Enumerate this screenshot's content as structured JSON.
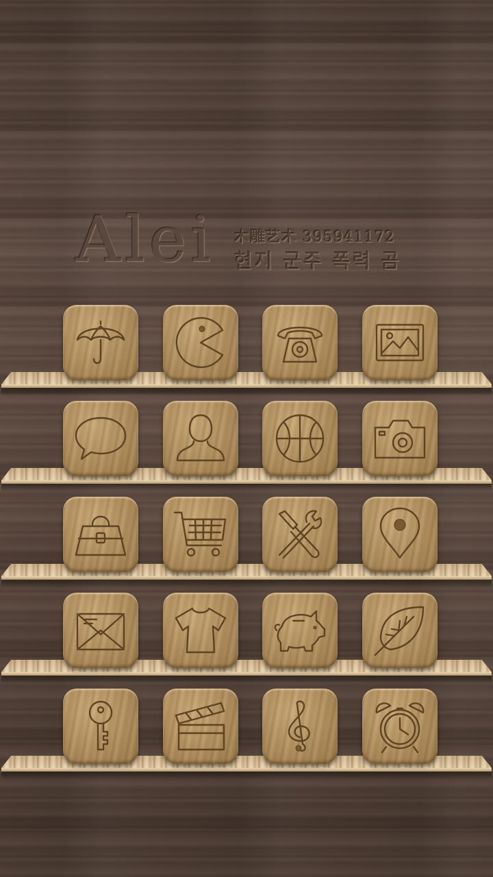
{
  "logo": {
    "word": "Alei",
    "line1": "木雕艺术 395941172",
    "line2": "현지 군주 폭력 곰"
  },
  "colors": {
    "wall": "#5b4a40",
    "shelf": "#d9c09b",
    "tile": "#b39161",
    "engrave": "#5e4322"
  },
  "shelves": [
    {
      "icons": [
        "umbrella-icon",
        "pacman-icon",
        "telephone-icon",
        "picture-icon"
      ]
    },
    {
      "icons": [
        "chat-bubble-icon",
        "contact-icon",
        "basketball-icon",
        "camera-icon"
      ]
    },
    {
      "icons": [
        "handbag-icon",
        "shopping-cart-icon",
        "tools-icon",
        "map-pin-icon"
      ]
    },
    {
      "icons": [
        "mail-icon",
        "tshirt-icon",
        "piggy-bank-icon",
        "leaf-icon"
      ]
    },
    {
      "icons": [
        "key-icon",
        "clapperboard-icon",
        "music-note-icon",
        "alarm-clock-icon"
      ]
    }
  ]
}
